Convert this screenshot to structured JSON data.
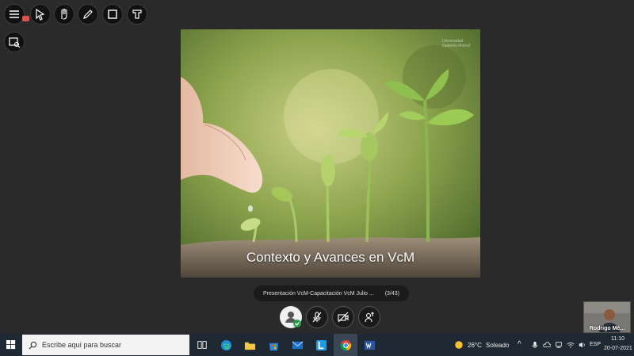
{
  "slide": {
    "title": "Contexto y Avances en VcM",
    "logo_text": "Universidad Gabriela Mistral"
  },
  "presentation_bar": {
    "name": "Presentación VcM-Capacitación VcM Julio ...",
    "counter": "(3/43)"
  },
  "video": {
    "participant_name": "Rodrigo Mé..."
  },
  "taskbar": {
    "search_placeholder": "Escribe aquí para buscar",
    "weather_temp": "26°C",
    "weather_desc": "Soleado",
    "language": "ESP",
    "time": "11:10",
    "date": "20-07-2021"
  },
  "colors": {
    "background": "#2a2a2a",
    "taskbar": "#1f2933",
    "chrome_active": "#3a4654"
  }
}
